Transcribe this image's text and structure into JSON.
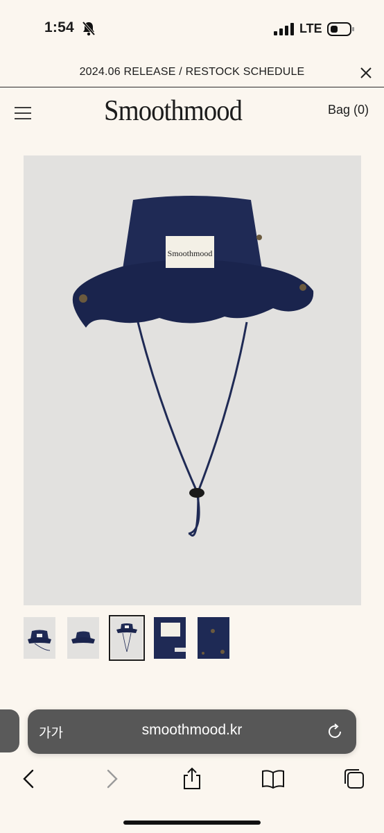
{
  "status_bar": {
    "time": "1:54",
    "network": "LTE"
  },
  "announcement": {
    "text": "2024.06 RELEASE / RESTOCK SCHEDULE"
  },
  "header": {
    "brand": "Smoothmood",
    "bag_label": "Bag (0)"
  },
  "product": {
    "label_text": "Smoothmood",
    "hat_color": "#1f2a55",
    "thumbnails": [
      {
        "view": "front-with-cord",
        "selected": false
      },
      {
        "view": "front",
        "selected": false
      },
      {
        "view": "front-with-cord-long",
        "selected": true
      },
      {
        "view": "label-closeup",
        "selected": false
      },
      {
        "view": "eyelet-closeup",
        "selected": false
      }
    ]
  },
  "browser": {
    "aa_label": "가가",
    "url": "smoothmood.kr",
    "toolbar_icons": [
      "back-icon",
      "forward-icon",
      "share-icon",
      "bookmarks-icon",
      "tabs-icon"
    ]
  }
}
